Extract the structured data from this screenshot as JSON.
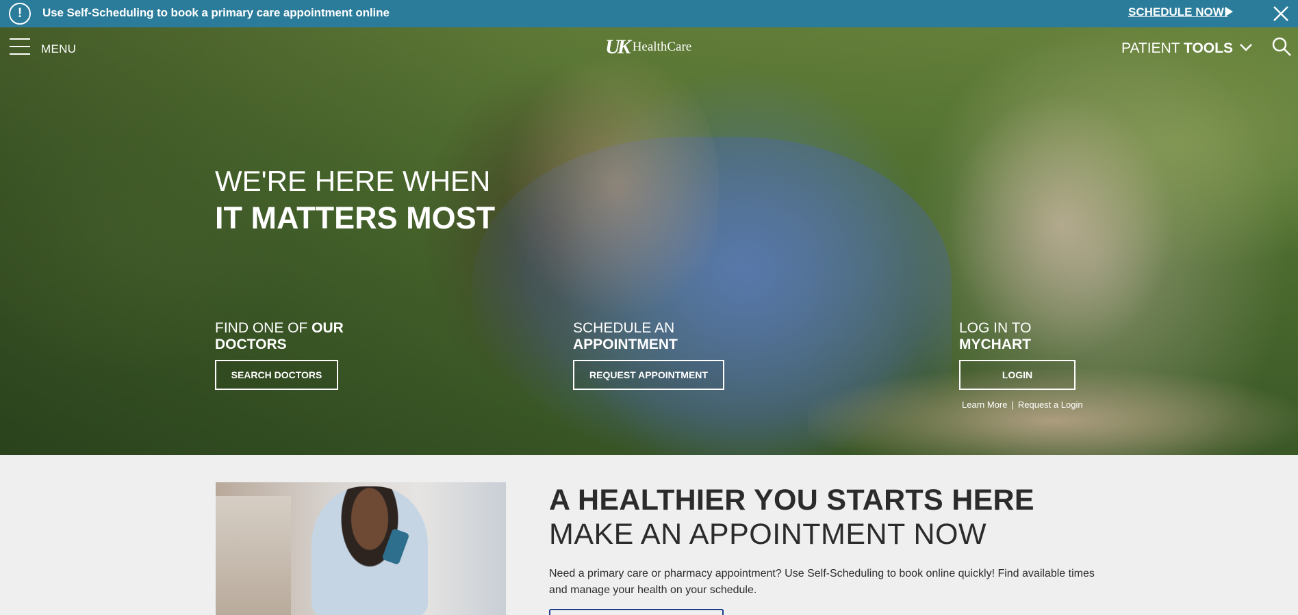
{
  "alert": {
    "text": "Use Self-Scheduling to book a primary care appointment online",
    "cta": "SCHEDULE NOW!",
    "icon": "exclamation-circle-icon",
    "color": "#2a7c9a"
  },
  "nav": {
    "menu_label": "MENU",
    "logo_mark": "UK",
    "logo_text": "HealthCare",
    "patient_tools_light": "PATIENT ",
    "patient_tools_bold": "TOOLS"
  },
  "hero": {
    "line1": "WE'RE HERE WHEN",
    "line2": "IT MATTERS MOST",
    "ctas": [
      {
        "title_light": "FIND ONE OF ",
        "title_bold": "OUR",
        "title_line2": "DOCTORS",
        "button": "SEARCH DOCTORS"
      },
      {
        "title_light": "SCHEDULE AN",
        "title_bold": "",
        "title_line2": "APPOINTMENT",
        "button": "REQUEST APPOINTMENT"
      },
      {
        "title_light": "LOG IN TO",
        "title_bold": "",
        "title_line2": "MYCHART",
        "button": "LOGIN"
      }
    ],
    "login_links": {
      "learn_more": "Learn More",
      "separator": "|",
      "request_login": "Request a Login"
    }
  },
  "promo": {
    "heading_bold": "A HEALTHIER YOU STARTS HERE",
    "heading_light": "MAKE AN APPOINTMENT NOW",
    "body": "Need a primary care or pharmacy appointment? Use Self-Scheduling to book online quickly! Find available times and manage your health on your schedule."
  }
}
